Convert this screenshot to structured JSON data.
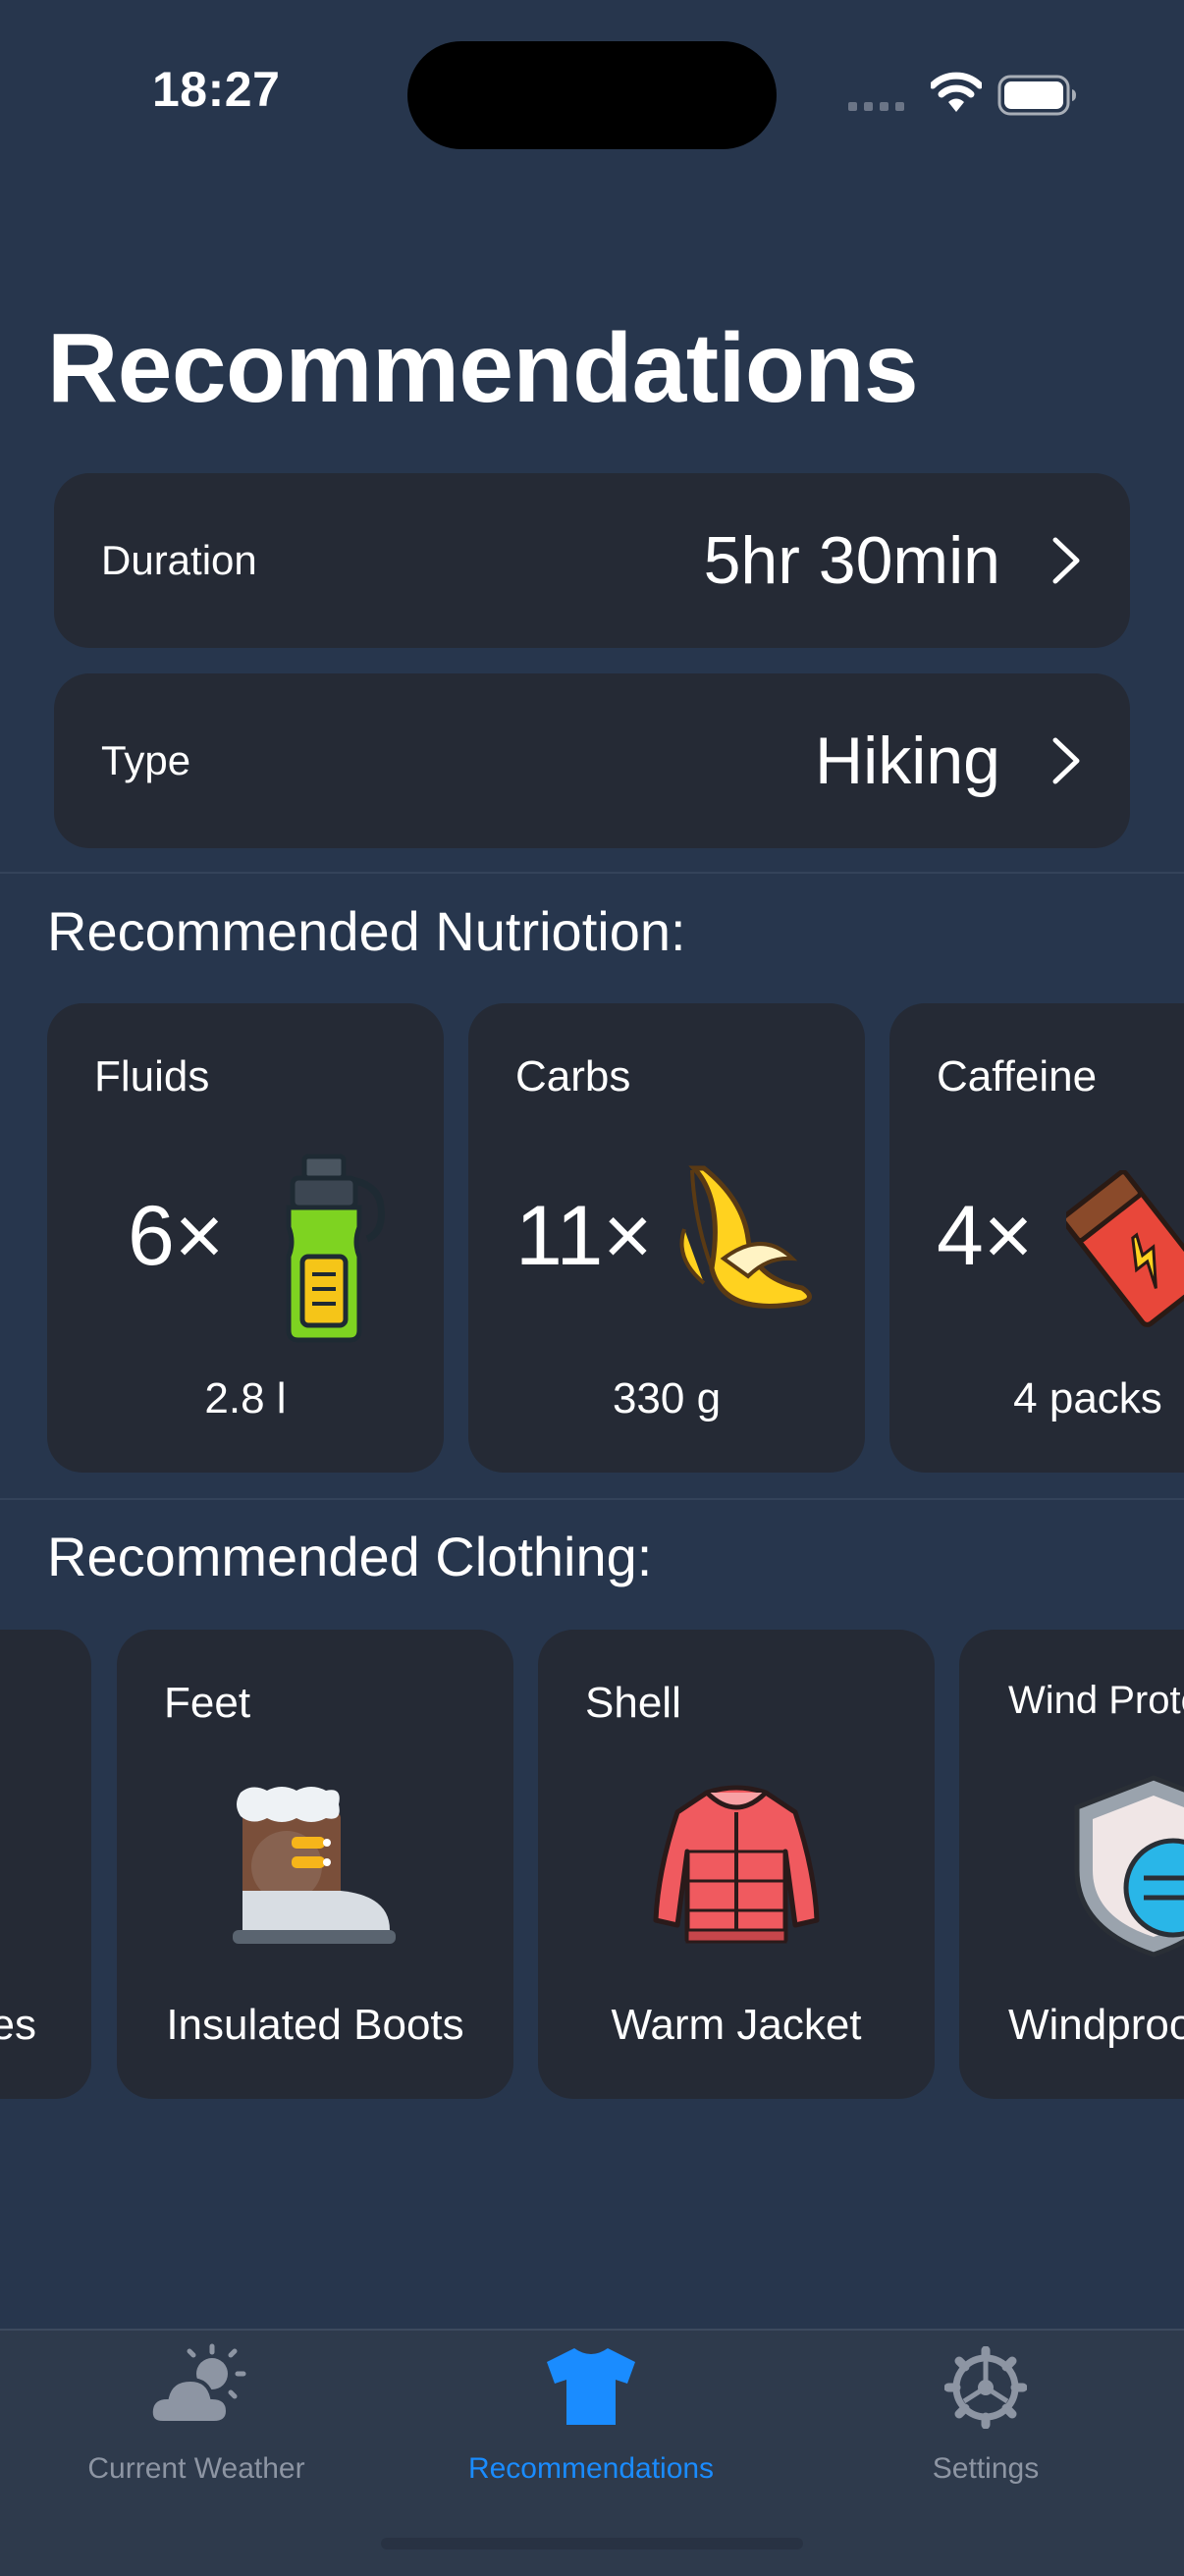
{
  "status_bar": {
    "time": "18:27"
  },
  "page": {
    "title": "Recommendations"
  },
  "settings_rows": [
    {
      "label": "Duration",
      "value": "5hr 30min"
    },
    {
      "label": "Type",
      "value": "Hiking"
    }
  ],
  "nutrition": {
    "title": "Recommended Nutriotion:",
    "items": [
      {
        "label": "Fluids",
        "count": "6×",
        "amount": "2.8 l",
        "icon": "water-bottle-icon"
      },
      {
        "label": "Carbs",
        "count": "11×",
        "amount": "330 g",
        "icon": "banana-icon"
      },
      {
        "label": "Caffeine",
        "count": "4×",
        "amount": "4 packs",
        "icon": "energy-bar-icon"
      }
    ]
  },
  "clothing": {
    "title": "Recommended Clothing:",
    "items": [
      {
        "label": "",
        "item": "es",
        "icon": ""
      },
      {
        "label": "Feet",
        "item": "Insulated Boots",
        "icon": "boot-icon"
      },
      {
        "label": "Shell",
        "item": "Warm Jacket",
        "icon": "jacket-icon"
      },
      {
        "label": "Wind Prote",
        "item": "Windproo",
        "icon": "wind-shield-icon"
      }
    ]
  },
  "tab_bar": {
    "tabs": [
      {
        "label": "Current Weather",
        "icon": "cloud-sun-icon",
        "active": false
      },
      {
        "label": "Recommendations",
        "icon": "tshirt-icon",
        "active": true
      },
      {
        "label": "Settings",
        "icon": "gear-icon",
        "active": false
      }
    ]
  },
  "colors": {
    "background": "#27364d",
    "card": "#252a35",
    "accent": "#1a8cff",
    "inactive": "#8d95a3"
  }
}
